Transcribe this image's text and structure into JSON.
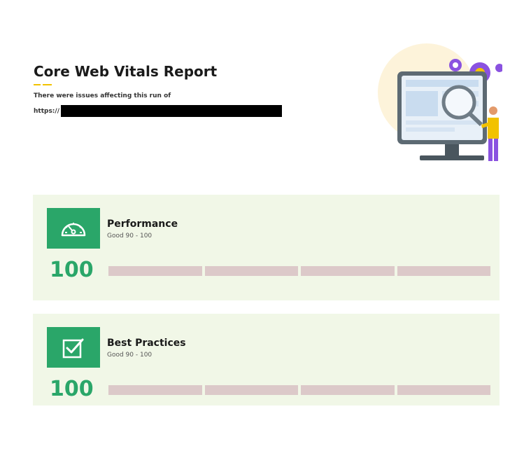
{
  "report": {
    "title": "Core Web Vitals Report",
    "subtitle": "There were issues affecting this run of",
    "url_prefix": "https://"
  },
  "cards": [
    {
      "icon": "speedometer-icon",
      "title": "Performance",
      "range": "Good 90 - 100",
      "score": "100",
      "segments": 4
    },
    {
      "icon": "checkbox-check-icon",
      "title": "Best Practices",
      "range": "Good 90 - 100",
      "score": "100",
      "segments": 4
    }
  ],
  "colors": {
    "accent_green": "#2aa669",
    "card_bg": "#f1f7e7",
    "bar_segment": "#dcc9c9",
    "title_underline": "#f2c200"
  }
}
